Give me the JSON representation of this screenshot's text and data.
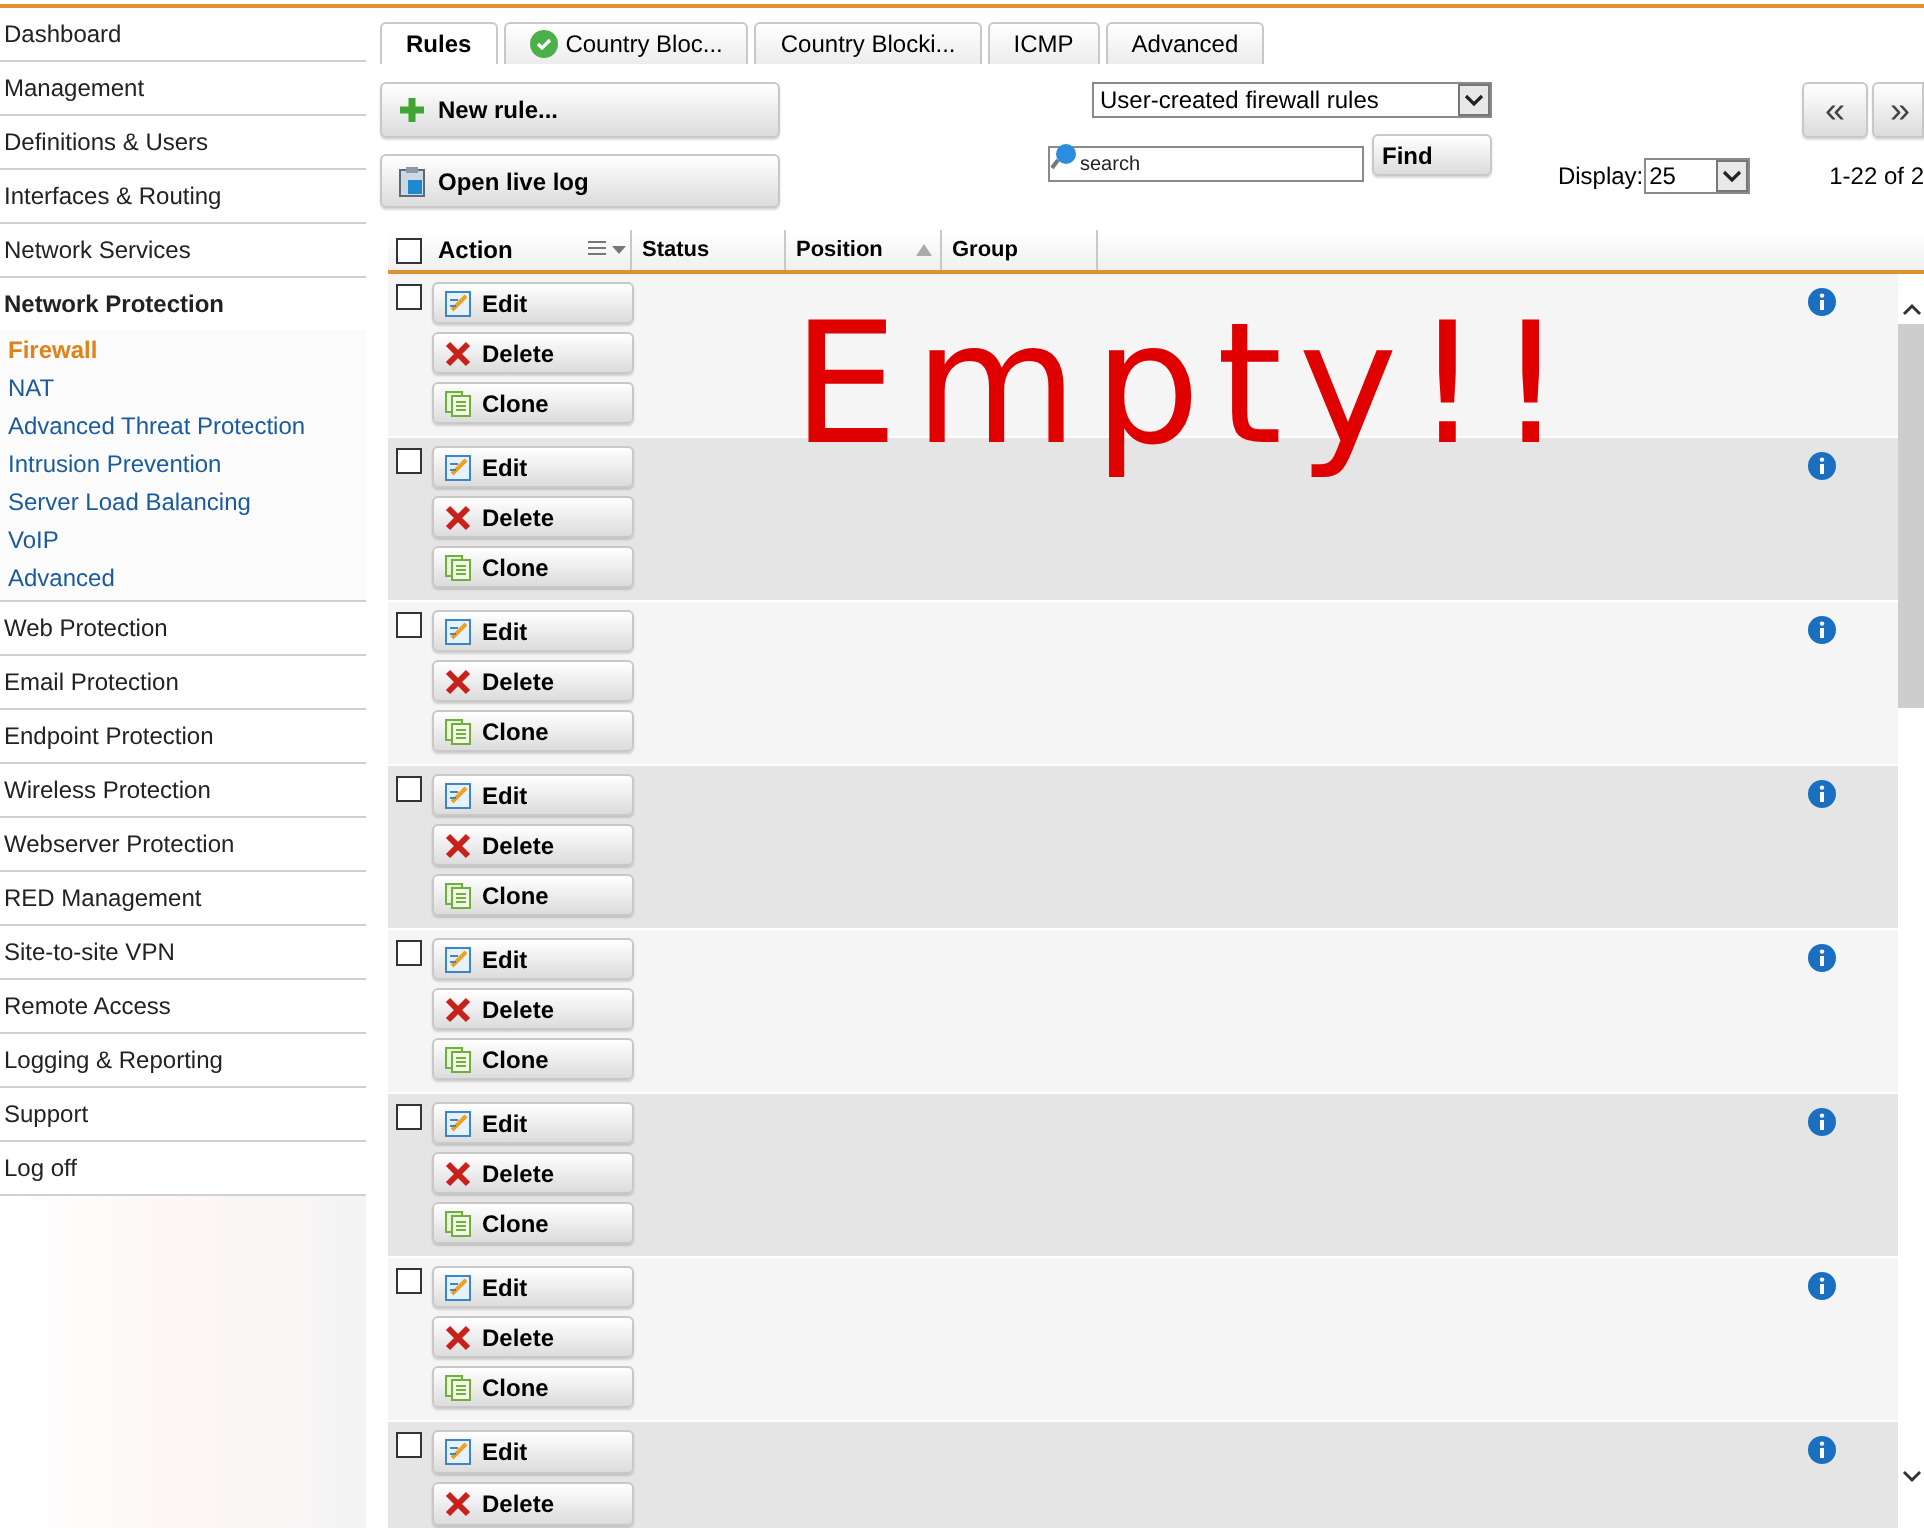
{
  "sidebar": {
    "items": [
      {
        "label": "Dashboard",
        "expanded": false
      },
      {
        "label": "Management",
        "expanded": false
      },
      {
        "label": "Definitions & Users",
        "expanded": false
      },
      {
        "label": "Interfaces & Routing",
        "expanded": false
      },
      {
        "label": "Network Services",
        "expanded": false
      },
      {
        "label": "Network Protection",
        "expanded": true,
        "children": [
          {
            "label": "Firewall",
            "selected": true
          },
          {
            "label": "NAT",
            "selected": false
          },
          {
            "label": "Advanced Threat Protection",
            "selected": false
          },
          {
            "label": "Intrusion Prevention",
            "selected": false
          },
          {
            "label": "Server Load Balancing",
            "selected": false
          },
          {
            "label": "VoIP",
            "selected": false
          },
          {
            "label": "Advanced",
            "selected": false
          }
        ]
      },
      {
        "label": "Web Protection",
        "expanded": false
      },
      {
        "label": "Email Protection",
        "expanded": false
      },
      {
        "label": "Endpoint Protection",
        "expanded": false
      },
      {
        "label": "Wireless Protection",
        "expanded": false
      },
      {
        "label": "Webserver Protection",
        "expanded": false
      },
      {
        "label": "RED Management",
        "expanded": false
      },
      {
        "label": "Site-to-site VPN",
        "expanded": false
      },
      {
        "label": "Remote Access",
        "expanded": false
      },
      {
        "label": "Logging & Reporting",
        "expanded": false
      },
      {
        "label": "Support",
        "expanded": false
      },
      {
        "label": "Log off",
        "expanded": false
      }
    ]
  },
  "tabs": [
    {
      "label": "Rules",
      "selected": true,
      "ok": false
    },
    {
      "label": "Country Bloc...",
      "selected": false,
      "ok": true
    },
    {
      "label": "Country Blocki...",
      "selected": false,
      "ok": false
    },
    {
      "label": "ICMP",
      "selected": false,
      "ok": false
    },
    {
      "label": "Advanced",
      "selected": false,
      "ok": false
    }
  ],
  "toolbar": {
    "new_rule": "New rule...",
    "open_live_log": "Open live log",
    "filter": "User-created firewall rules",
    "search_placeholder": "search",
    "find": "Find",
    "display_label": "Display:",
    "display_value": "25",
    "prev": "«",
    "next": "»",
    "range": "1-22 of 2"
  },
  "table": {
    "select_all_checked": false,
    "columns": [
      "Action",
      "Status",
      "Position",
      "Group"
    ],
    "rows": [
      {
        "checked": false,
        "buttons": [
          {
            "kind": "edit",
            "label": "Edit"
          },
          {
            "kind": "delete",
            "label": "Delete"
          },
          {
            "kind": "clone",
            "label": "Clone"
          }
        ]
      },
      {
        "checked": false,
        "buttons": [
          {
            "kind": "edit",
            "label": "Edit"
          },
          {
            "kind": "delete",
            "label": "Delete"
          },
          {
            "kind": "clone",
            "label": "Clone"
          }
        ]
      },
      {
        "checked": false,
        "buttons": [
          {
            "kind": "edit",
            "label": "Edit"
          },
          {
            "kind": "delete",
            "label": "Delete"
          },
          {
            "kind": "clone",
            "label": "Clone"
          }
        ]
      },
      {
        "checked": false,
        "buttons": [
          {
            "kind": "edit",
            "label": "Edit"
          },
          {
            "kind": "delete",
            "label": "Delete"
          },
          {
            "kind": "clone",
            "label": "Clone"
          }
        ]
      },
      {
        "checked": false,
        "buttons": [
          {
            "kind": "edit",
            "label": "Edit"
          },
          {
            "kind": "delete",
            "label": "Delete"
          },
          {
            "kind": "clone",
            "label": "Clone"
          }
        ]
      },
      {
        "checked": false,
        "buttons": [
          {
            "kind": "edit",
            "label": "Edit"
          },
          {
            "kind": "delete",
            "label": "Delete"
          },
          {
            "kind": "clone",
            "label": "Clone"
          }
        ]
      },
      {
        "checked": false,
        "buttons": [
          {
            "kind": "edit",
            "label": "Edit"
          },
          {
            "kind": "delete",
            "label": "Delete"
          },
          {
            "kind": "clone",
            "label": "Clone"
          }
        ]
      },
      {
        "checked": false,
        "buttons": [
          {
            "kind": "edit",
            "label": "Edit"
          },
          {
            "kind": "delete",
            "label": "Delete"
          }
        ]
      }
    ]
  },
  "annotation": "Empty!!"
}
